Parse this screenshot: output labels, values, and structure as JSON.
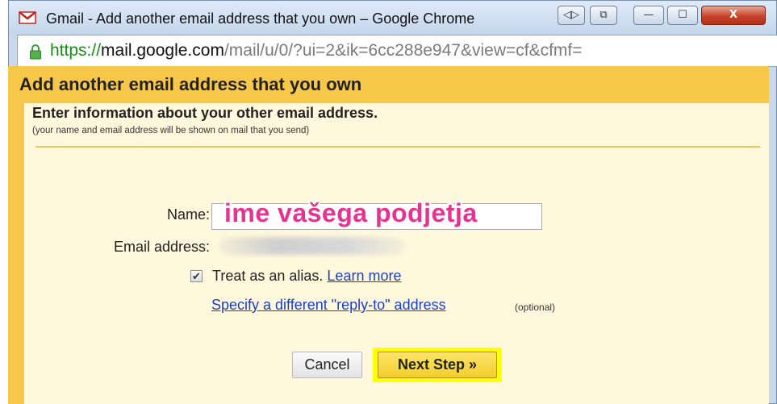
{
  "window": {
    "title": "Gmail - Add another email address that you own – Google Chrome",
    "buttons": {
      "nav_label": "◁▷",
      "page_label": "⧉",
      "minimize_label": "—",
      "maximize_label": "☐",
      "close_label": "X"
    }
  },
  "addressbar": {
    "scheme": "https://",
    "host": "mail.google.com",
    "path": "/mail/u/0/?ui=2&ik=6cc288e947&view=cf&cfmf="
  },
  "dialog": {
    "title": "Add another email address that you own",
    "heading": "Enter information about your other email address.",
    "subheading": "(your name and email address will be shown on mail that you send)",
    "name_label": "Name:",
    "name_value": "",
    "name_overlay": "ime vašega podjetja",
    "email_label": "Email address:",
    "alias_checked": true,
    "alias_text": "Treat as an alias.",
    "learn_more": "Learn more",
    "reply_to_link": "Specify a different \"reply-to\" address",
    "optional": "(optional)",
    "cancel_label": "Cancel",
    "next_label": "Next Step »"
  },
  "colors": {
    "header_bg": "#f6c749",
    "panel_bg": "#fff8dc",
    "highlight": "#ffff00",
    "overlay_text": "#e4348f",
    "link": "#1a3fc7"
  }
}
